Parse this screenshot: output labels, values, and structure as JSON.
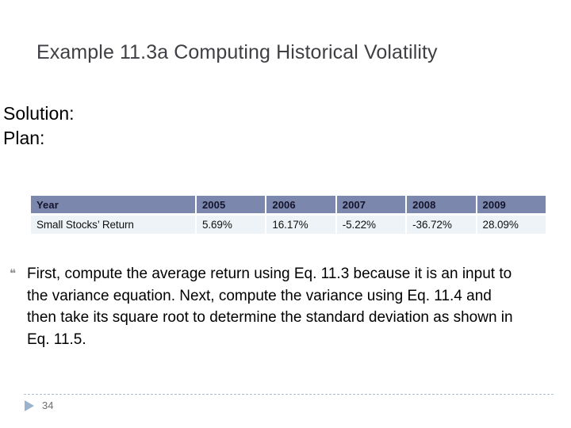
{
  "slide": {
    "title": "Example 11.3a Computing Historical Volatility",
    "title_color": "#3f3f44"
  },
  "lead": {
    "line1": "Solution:",
    "line2": "Plan:"
  },
  "table": {
    "header_bg": "#7b87ad",
    "body_bg": "#edf3f6",
    "headers": [
      "Year",
      "2005",
      "2006",
      "2007",
      "2008",
      "2009"
    ],
    "rows": [
      {
        "label": "Small Stocks’ Return",
        "values": [
          "5.69%",
          "16.17%",
          "-5.22%",
          "-36.72%",
          "28.09%"
        ]
      }
    ]
  },
  "body": {
    "bullet_glyph": "❝",
    "paragraph": "First, compute the average return using Eq. 11.3 because it is an input to the variance equation. Next, compute the variance using Eq. 11.4 and then take its square root to determine the standard deviation as shown in Eq. 11.5."
  },
  "footer": {
    "page_number": "34",
    "marker_color": "#9bb3cc",
    "rule_color": "#a8bed6"
  }
}
